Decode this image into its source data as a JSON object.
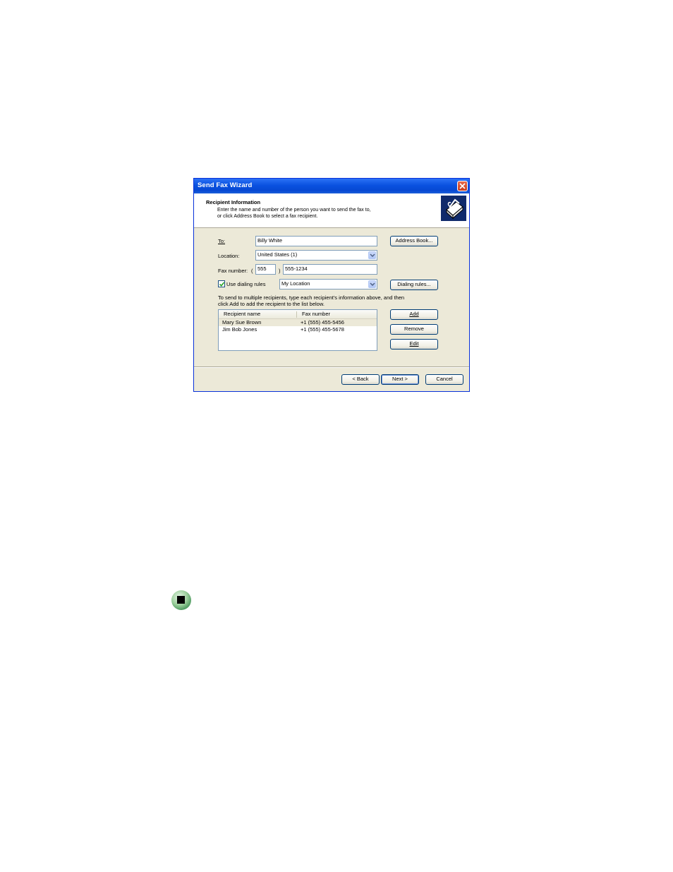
{
  "window": {
    "title": "Send Fax Wizard",
    "close_icon": "close-icon"
  },
  "header": {
    "title": "Recipient Information",
    "desc_line1": "Enter the name and number of the person you want to send the fax to,",
    "desc_line2": "or click Address Book to select a fax recipient.",
    "icon": "fax-machine-icon"
  },
  "form": {
    "to_label": "To:",
    "to_value": "Billy White",
    "address_book_label": "Address Book...",
    "location_label": "Location:",
    "location_value": "United States (1)",
    "fax_label": "Fax number:",
    "fax_open_paren": "(",
    "fax_area_code": "555",
    "fax_close_paren": ")",
    "fax_number": "555-1234",
    "use_dialing_rules_label": "Use dialing rules",
    "use_dialing_rules_checked": true,
    "dialing_location_value": "My Location",
    "dialing_rules_button": "Dialing rules...",
    "instructions_line1": "To send to multiple recipients, type each recipient's information above, and then",
    "instructions_line2": "click Add to add the recipient to the list below."
  },
  "recipients": {
    "columns": [
      "Recipient name",
      "Fax number"
    ],
    "rows": [
      {
        "name": "Mary Sue Brown",
        "fax": "+1 (555) 455-5456"
      },
      {
        "name": "Jim Bob Jones",
        "fax": "+1 (555) 455-5678"
      }
    ],
    "add_label": "Add",
    "remove_label": "Remove",
    "edit_label": "Edit"
  },
  "footer": {
    "back_label": "< Back",
    "next_label": "Next >",
    "cancel_label": "Cancel"
  },
  "page_icon": "stop-icon",
  "colors": {
    "titlebar": "#0a52e0",
    "dialog_bg": "#ece9d8",
    "stop_icon_green": "#3f8f54"
  }
}
